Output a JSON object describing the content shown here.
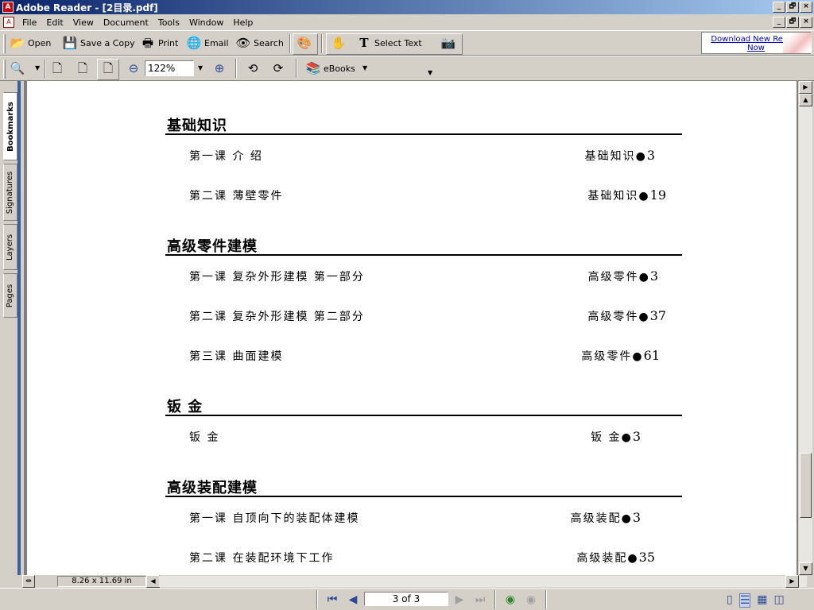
{
  "window": {
    "title": "Adobe Reader - [2目录.pdf]",
    "min": "_",
    "max": "🗗",
    "close": "×"
  },
  "menu": [
    "File",
    "Edit",
    "View",
    "Document",
    "Tools",
    "Window",
    "Help"
  ],
  "toolbar1": {
    "open": "Open",
    "save_copy": "Save a Copy",
    "print": "Print",
    "email": "Email",
    "search": "Search",
    "select_text": "Select Text",
    "download": "Download New Reader Now"
  },
  "toolbar2": {
    "zoom": "122%",
    "ebooks": "eBooks"
  },
  "sidetabs": [
    "Bookmarks",
    "Signatures",
    "Layers",
    "Pages"
  ],
  "document": {
    "sections": [
      {
        "title": "基础知识",
        "entries": [
          {
            "lesson": "第一课  介 绍",
            "ref": "基础知识",
            "page": "3"
          },
          {
            "lesson": "第二课  薄壁零件",
            "ref": "基础知识",
            "page": "19"
          }
        ]
      },
      {
        "title": "高级零件建模",
        "entries": [
          {
            "lesson": "第一课  复杂外形建模  第一部分",
            "ref": "高级零件",
            "page": "3"
          },
          {
            "lesson": "第二课  复杂外形建模  第二部分",
            "ref": "高级零件",
            "page": "37"
          },
          {
            "lesson": "第三课  曲面建模",
            "ref": "高级零件",
            "page": "61"
          }
        ]
      },
      {
        "title": "钣   金",
        "entries": [
          {
            "lesson": "钣   金",
            "ref": "钣    金",
            "page": "3"
          }
        ]
      },
      {
        "title": "高级装配建模",
        "entries": [
          {
            "lesson": "第一课  自顶向下的装配体建模",
            "ref": "高级装配",
            "page": "3"
          },
          {
            "lesson": "第二课  在装配环境下工作",
            "ref": "高级装配",
            "page": "35"
          }
        ]
      }
    ],
    "bullet": "●"
  },
  "status": {
    "page_size": "8.26 x 11.69 in",
    "page_indicator": "3 of 3"
  }
}
